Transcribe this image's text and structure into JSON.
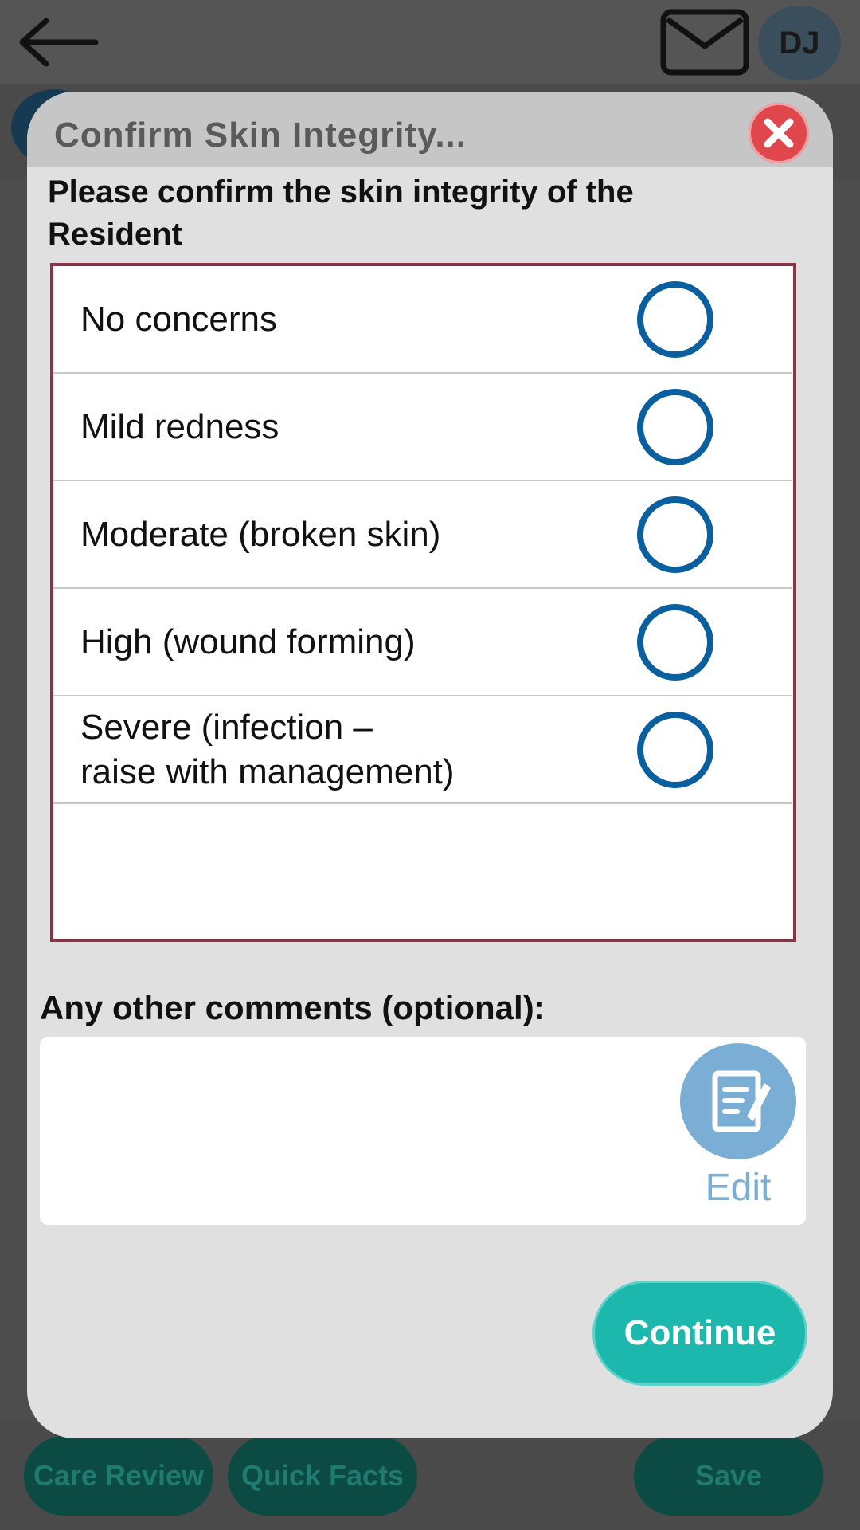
{
  "header": {
    "avatar_initials": "DJ"
  },
  "modal": {
    "title": "Confirm Skin Integrity...",
    "prompt": "Please confirm the skin integrity of the Resident",
    "options": [
      {
        "label": "No concerns",
        "selected": false
      },
      {
        "label": "Mild redness",
        "selected": false
      },
      {
        "label": "Moderate (broken skin)",
        "selected": false
      },
      {
        "label": "High (wound forming)",
        "selected": false
      },
      {
        "label": "Severe (infection –\nraise with management)",
        "selected": false
      }
    ],
    "comments_label": "Any other comments (optional):",
    "comments_value": "",
    "edit_label": "Edit",
    "continue_label": "Continue"
  },
  "bottom_bar": {
    "care_review_label": "Care Review",
    "quick_facts_label": "Quick Facts",
    "save_label": "Save"
  },
  "colors": {
    "accent_teal": "#1cb7ad",
    "radio_blue": "#0a5f9e",
    "options_border": "#8c3345",
    "close_red": "#e0474d",
    "edit_blue": "#7aaed5"
  },
  "icons": {
    "back": "arrow-left-icon",
    "mail": "envelope-icon",
    "close": "close-icon",
    "edit": "edit-note-icon"
  }
}
